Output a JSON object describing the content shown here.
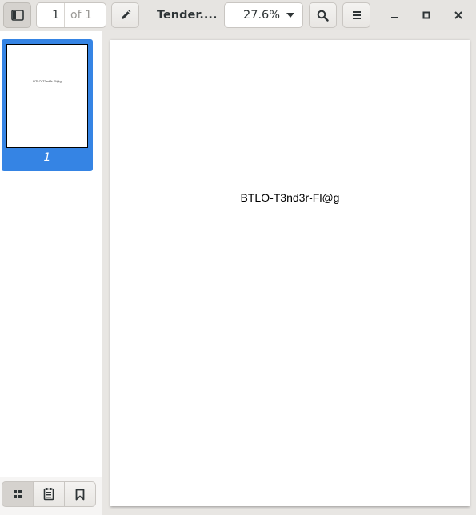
{
  "header": {
    "page_number": "1",
    "page_of": "of 1",
    "title": "Tender....",
    "zoom": "27.6%"
  },
  "sidebar": {
    "thumbnails": [
      {
        "label": "1",
        "preview_text": "BTLO-T3nd3r-Fl@g"
      }
    ],
    "modes": [
      "thumbnails-icon",
      "outline-icon",
      "bookmarks-icon"
    ]
  },
  "document": {
    "page_text": "BTLO-T3nd3r-Fl@g"
  },
  "icons": {
    "sidebar_toggle": "sidebar-icon",
    "annotate": "pencil-icon",
    "search": "search-icon",
    "menu": "hamburger-icon",
    "minimize": "minimize-icon",
    "maximize": "maximize-icon",
    "close": "close-icon"
  },
  "colors": {
    "accent": "#3584e4",
    "headerbar": "#e6e4e1",
    "text": "#2e3436"
  }
}
